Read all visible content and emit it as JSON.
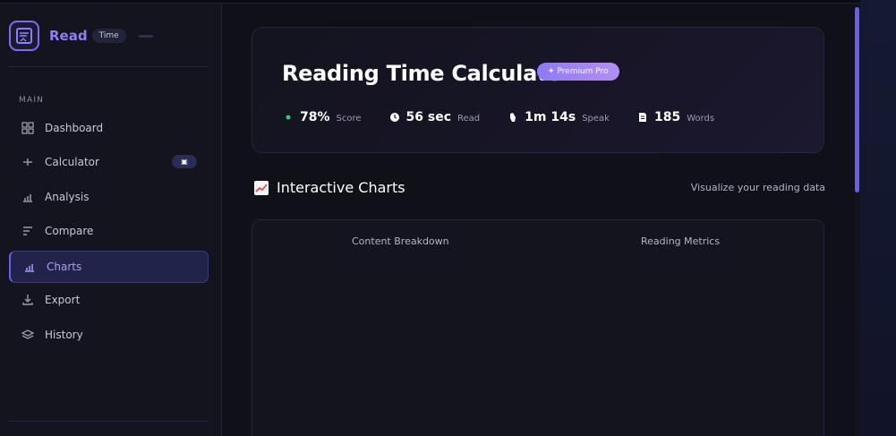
{
  "brand": {
    "name": "Read",
    "chip": "Time"
  },
  "sidebar": {
    "section": "MAIN",
    "items": [
      {
        "label": "Dashboard",
        "icon": "grid-icon"
      },
      {
        "label": "Calculator",
        "icon": "calculator-icon",
        "badge": "▣"
      },
      {
        "label": "Analysis",
        "icon": "bar-chart-icon"
      },
      {
        "label": "Compare",
        "icon": "lines-icon"
      },
      {
        "label": "Charts",
        "icon": "chart-icon",
        "active": true
      },
      {
        "label": "Export",
        "icon": "download-icon"
      },
      {
        "label": "History",
        "icon": "layers-icon"
      }
    ]
  },
  "hero": {
    "title": "Reading Time Calculator",
    "badge": "✦ Premium Pro",
    "stats": [
      {
        "value": "78%",
        "label": "Score",
        "icon": "dot-icon"
      },
      {
        "value": "56 sec",
        "label": "Read",
        "icon": "clock-icon"
      },
      {
        "value": "1m 14s",
        "label": "Speak",
        "icon": "hand-icon"
      },
      {
        "value": "185",
        "label": "Words",
        "icon": "document-icon"
      }
    ]
  },
  "charts_section": {
    "title": "Interactive Charts",
    "subtitle": "Visualize your reading data",
    "left_label": "Content Breakdown",
    "right_label": "Reading Metrics"
  },
  "colors": {
    "accent": "#6a5cf0",
    "background": "#0f1018",
    "sidebar": "#13141d",
    "score_dot": "#2ecc71"
  }
}
